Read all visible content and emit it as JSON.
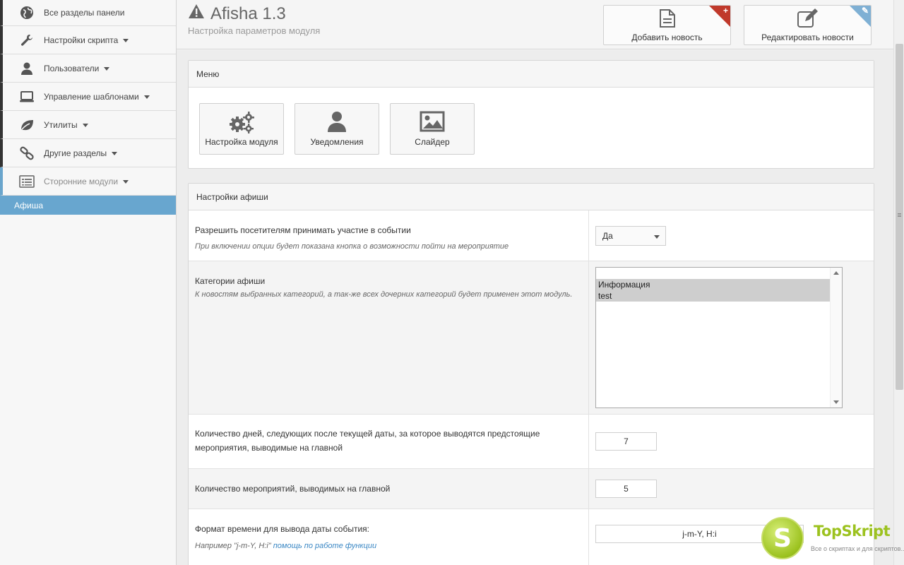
{
  "sidebar": {
    "items": [
      {
        "label": "Все разделы панели",
        "icon": "globe-icon",
        "dropdown": false
      },
      {
        "label": "Настройки скрипта",
        "icon": "wrench-icon",
        "dropdown": true
      },
      {
        "label": "Пользователи",
        "icon": "user-icon",
        "dropdown": true
      },
      {
        "label": "Управление шаблонами",
        "icon": "laptop-icon",
        "dropdown": true
      },
      {
        "label": "Утилиты",
        "icon": "leaf-icon",
        "dropdown": true
      },
      {
        "label": "Другие разделы",
        "icon": "link-icon",
        "dropdown": true
      },
      {
        "label": "Сторонние модули",
        "icon": "list-icon",
        "dropdown": true,
        "active": true
      }
    ],
    "sub_item": "Афиша"
  },
  "header": {
    "title": "Afisha 1.3",
    "subtitle": "Настройка параметров модуля",
    "add_news_label": "Добавить новость",
    "edit_news_label": "Редактировать новости",
    "add_corner_symbol": "+",
    "edit_corner_symbol": "✎"
  },
  "menu_panel": {
    "title": "Меню",
    "buttons": [
      {
        "label": "Настройка модуля",
        "icon": "gears-icon"
      },
      {
        "label": "Уведомления",
        "icon": "user-icon"
      },
      {
        "label": "Слайдер",
        "icon": "image-icon"
      }
    ]
  },
  "settings_panel": {
    "title": "Настройки афиши",
    "rows": {
      "participation": {
        "label": "Разрешить посетителям принимать участие в событии",
        "hint": "При включении опции будет показана кнопка о возможности пойти на мероприятие",
        "value": "Да"
      },
      "categories": {
        "label": "Категории афиши",
        "hint": "К новостям выбранных категорий, а так-же всех дочерних категорий будет применен этот модуль.",
        "options": [
          "Информация",
          "test"
        ]
      },
      "days": {
        "label": "Количество дней, следующих после текущей даты, за которое выводятся предстоящие мероприятия, выводимые на главной",
        "value": "7"
      },
      "count": {
        "label": "Количество мероприятий, выводимых на главной",
        "value": "5"
      },
      "time_format": {
        "label": "Формат времени для вывода даты события:",
        "hint_prefix": "Например \"j-m-Y, H:i\" ",
        "hint_link": "помощь по работе функции",
        "value": "j-m-Y, H:i"
      }
    }
  },
  "watermark": {
    "letter": "S",
    "brand": "TopSkript",
    "tagline": "Все о скриптах и для скриптов..."
  },
  "colors": {
    "accent": "#68a6cf",
    "add_corner": "#c0392b",
    "edit_corner": "#7fb0d4",
    "link": "#3a87c4"
  }
}
